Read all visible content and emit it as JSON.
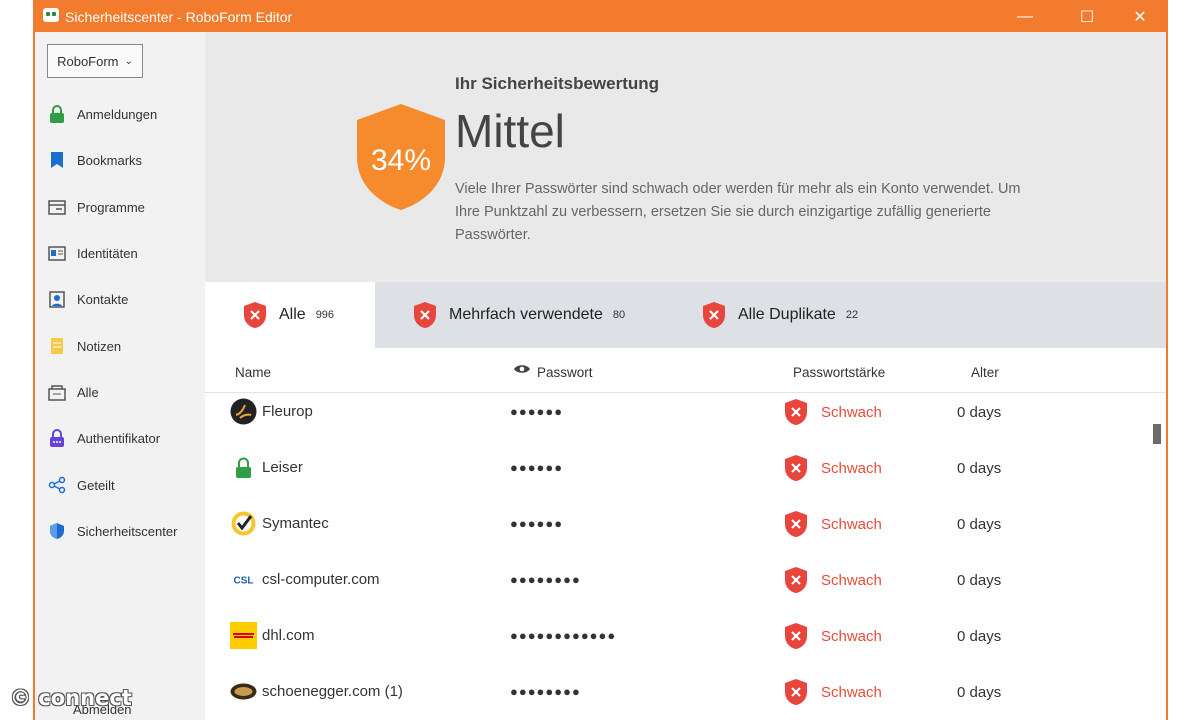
{
  "window": {
    "title": "Sicherheitscenter - RoboForm Editor",
    "controls": {
      "minimize": "—",
      "maximize": "☐",
      "close": "✕"
    }
  },
  "sidebar": {
    "account_label": "RoboForm",
    "items": [
      {
        "label": "Anmeldungen",
        "icon": "lock-icon"
      },
      {
        "label": "Bookmarks",
        "icon": "bookmark-icon"
      },
      {
        "label": "Programme",
        "icon": "window-icon"
      },
      {
        "label": "Identitäten",
        "icon": "id-card-icon"
      },
      {
        "label": "Kontakte",
        "icon": "contact-icon"
      },
      {
        "label": "Notizen",
        "icon": "note-icon"
      },
      {
        "label": "Alle",
        "icon": "all-icon"
      },
      {
        "label": "Authentifikator",
        "icon": "authenticator-icon"
      },
      {
        "label": "Geteilt",
        "icon": "share-icon"
      },
      {
        "label": "Sicherheitscenter",
        "icon": "shield-icon"
      }
    ],
    "logout_label": "Abmelden"
  },
  "score": {
    "percent": "34%",
    "heading": "Ihr Sicherheitsbewertung",
    "level": "Mittel",
    "description": "Viele Ihrer Passwörter sind schwach oder werden für mehr als ein Konto verwendet. Um Ihre Punktzahl zu verbessern, ersetzen Sie sie durch einzigartige zufällig generierte Passwörter.",
    "color": "#f58b2c"
  },
  "tabs": [
    {
      "label": "Alle",
      "count": "996",
      "active": true
    },
    {
      "label": "Mehrfach verwendete",
      "count": "80",
      "active": false
    },
    {
      "label": "Alle Duplikate",
      "count": "22",
      "active": false
    }
  ],
  "columns": {
    "name": "Name",
    "password": "Passwort",
    "strength": "Passwortstärke",
    "age": "Alter"
  },
  "rows": [
    {
      "name": "Fleurop",
      "password": "●●●●●●",
      "strength": "Schwach",
      "age": "0 days",
      "logo": "fleurop-logo"
    },
    {
      "name": "Leiser",
      "password": "●●●●●●",
      "strength": "Schwach",
      "age": "0 days",
      "logo": "lock-icon"
    },
    {
      "name": "Symantec",
      "password": "●●●●●●",
      "strength": "Schwach",
      "age": "0 days",
      "logo": "symantec-logo"
    },
    {
      "name": "csl-computer.com",
      "password": "●●●●●●●●",
      "strength": "Schwach",
      "age": "0 days",
      "logo": "csl-logo"
    },
    {
      "name": "dhl.com",
      "password": "●●●●●●●●●●●●",
      "strength": "Schwach",
      "age": "0 days",
      "logo": "dhl-logo"
    },
    {
      "name": "schoenegger.com (1)",
      "password": "●●●●●●●●",
      "strength": "Schwach",
      "age": "0 days",
      "logo": "schoenegger-logo"
    }
  ],
  "watermark": "© connect",
  "colors": {
    "accent": "#f37b2d",
    "weak": "#e74c3c"
  }
}
